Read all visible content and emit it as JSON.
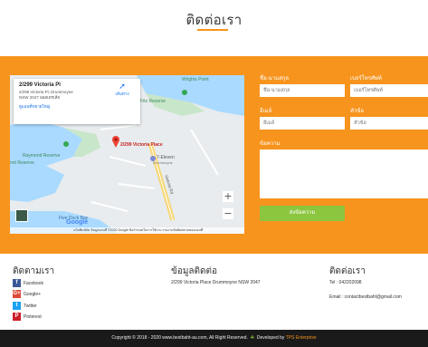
{
  "page": {
    "title": "ติดต่อเรา"
  },
  "colors": {
    "accent": "#f7941d",
    "button": "#8cc63f",
    "bar": "#1a1a1a"
  },
  "map": {
    "card_title": "2/299 Victoria Pl",
    "card_address": "2/299 Victoria Pl, Drummoyne NSW 2047 ออสเตรเลีย",
    "card_link": "ดูแผนที่ขยายใหญ่",
    "directions_label": "เส้นทาง",
    "marker_label": "2/299 Victoria Place",
    "labels": {
      "wrights_point": "Wrights Point",
      "fitz_reserve": "Fitz Reserve",
      "raymond_reserve": "Raymond Reserve",
      "ont_reserve": "ont Reserve",
      "seven_eleven": "7-Eleven",
      "seven_eleven_sub": "Drummoyne",
      "victoria_rd": "Victoria Rd",
      "five_dock_bay": "Five Dock Bay",
      "google": "Google"
    },
    "footer_text": "แป้นพิมพ์ลัด  ข้อมูลแผนที่ ©2020 Google  ข้อกำหนดในการใช้งาน  รายงานข้อผิดพลาดของแผนที่",
    "zoom_in": "+",
    "zoom_out": "−"
  },
  "form": {
    "name_label": "ชื่อ-นามสกุล",
    "name_placeholder": "ชื่อ-นามสกุล",
    "phone_label": "เบอร์โทรศัพท์",
    "phone_placeholder": "เบอร์โทรศัพท์",
    "email_label": "อีเมล์",
    "email_placeholder": "อีเมล์",
    "subject_label": "หัวข้อ",
    "subject_placeholder": "หัวข้อ",
    "message_label": "ข้อความ",
    "send_label": "ส่งข้อความ"
  },
  "footer": {
    "follow_title": "ติดตามเรา",
    "social": [
      {
        "label": "Facebook",
        "icon": "f",
        "color": "#3b5998"
      },
      {
        "label": "Google+",
        "icon": "G+",
        "color": "#dd4b39"
      },
      {
        "label": "Twitter",
        "icon": "t",
        "color": "#1da1f2"
      },
      {
        "label": "Pinterest",
        "icon": "P",
        "color": "#cb2027"
      }
    ],
    "info_title": "ข้อมูลติดต่อ",
    "info_address": "2/299 Victoria Place Drummoyne NSW 2047",
    "contact_title": "ติดต่อเรา",
    "contact_tel": "Tel : 042202098",
    "contact_email": "Email : contactbestbaht@gmail.com"
  },
  "copyright": {
    "text": "Copyright © 2018 - 2020 www.bestbaht-au.com, All Right Reserved.",
    "developed_by": "Developed by",
    "developer": "TPS Enterprise"
  }
}
